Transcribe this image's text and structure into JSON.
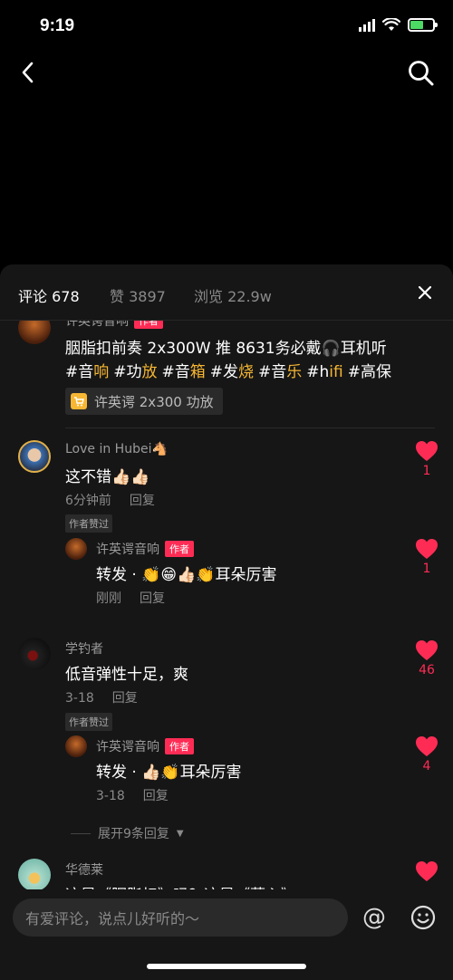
{
  "status_bar": {
    "time": "9:19"
  },
  "tabs": [
    {
      "label": "评论 678",
      "active": true
    },
    {
      "label": "赞 3897",
      "active": false
    },
    {
      "label": "浏览 22.9w",
      "active": false
    }
  ],
  "post": {
    "author": "许英谔音响",
    "author_tag": "作者",
    "line1": "胭脂扣前奏 2x300W 推 8631务必戴🎧耳机听",
    "hashtags": [
      {
        "prefix": "#音",
        "hl": "响"
      },
      {
        "prefix": "#功",
        "hl": "放"
      },
      {
        "prefix": "#音",
        "hl": "箱"
      },
      {
        "prefix": "#发",
        "hl": "烧"
      },
      {
        "prefix": "#音",
        "hl": "乐"
      },
      {
        "prefix": "#h",
        "hl": "ifi"
      },
      {
        "prefix": "#高保",
        "hl": ""
      }
    ],
    "product_label": "许英谔 2x300 功放"
  },
  "comments": [
    {
      "user": "Love in Hubei🐴",
      "text": "这不错👍🏻👍🏻",
      "time": "6分钟前",
      "reply_label": "回复",
      "author_liked": "作者赞过",
      "likes": "1",
      "reply": {
        "user": "许英谔音响",
        "tag": "作者",
        "text_prefix": "转发 · ",
        "text_suffix": "耳朵厉害",
        "time": "刚刚",
        "reply_label": "回复",
        "likes": "1"
      }
    },
    {
      "user": "学钓者",
      "text": "低音弹性十足，爽",
      "time": "3-18",
      "reply_label": "回复",
      "author_liked": "作者赞过",
      "likes": "46",
      "reply": {
        "user": "许英谔音响",
        "tag": "作者",
        "text_prefix": "转发 · ",
        "text_suffix": "耳朵厉害",
        "time": "3-18",
        "reply_label": "回复",
        "likes": "4"
      },
      "expand_label": "展开9条回复"
    },
    {
      "user": "华德莱",
      "text": "这是《胭脂扣》吗？这是《葬心》"
    }
  ],
  "input": {
    "placeholder": "有爱评论，说点儿好听的～"
  },
  "colors": {
    "accent": "#fe2c55",
    "highlight": "#f7b733",
    "sheet_bg": "#161616"
  }
}
